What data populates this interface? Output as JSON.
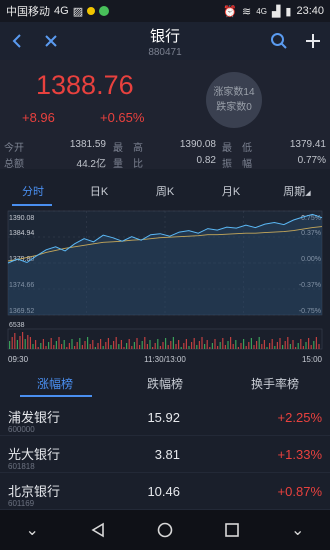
{
  "status": {
    "carrier": "中国移动",
    "net": "4G",
    "time": "23:40",
    "net2": "4G"
  },
  "nav": {
    "title": "银行",
    "code": "880471",
    "back": "‹",
    "close": "✕",
    "add": "+"
  },
  "quote": {
    "price": "1388.76",
    "change": "+8.96",
    "change_pct": "+0.65%",
    "bubble_up": "涨家数14",
    "bubble_down": "跌家数0"
  },
  "stats": [
    {
      "label": "今开",
      "value": "1381.59"
    },
    {
      "label": "最　高",
      "value": "1390.08"
    },
    {
      "label": "最　低",
      "value": "1379.41"
    },
    {
      "label": "总额",
      "value": "44.2亿"
    },
    {
      "label": "量　比",
      "value": "0.82"
    },
    {
      "label": "振　幅",
      "value": "0.77%"
    }
  ],
  "tabs": [
    "分时",
    "日K",
    "周K",
    "月K",
    "周期"
  ],
  "chart_data": {
    "type": "line",
    "title": "",
    "y_ticks_left": [
      "1390.08",
      "1384.94",
      "1379.80",
      "1374.66",
      "1369.52"
    ],
    "y_ticks_right": [
      "0.75%",
      "0.37%",
      "0.00%",
      "-0.37%",
      "-0.75%"
    ],
    "ylim": [
      1369.52,
      1390.08
    ],
    "x_ticks": [
      "09:30",
      "11:30/13:00",
      "15:00"
    ],
    "volume_max_label": "6538",
    "series": [
      {
        "values": [
          1379.8,
          1380.6,
          1379.9,
          1381.2,
          1382.4,
          1383.0,
          1382.2,
          1383.6,
          1384.6,
          1384.0,
          1385.3,
          1384.8,
          1384.1,
          1385.0,
          1384.3,
          1385.4,
          1385.6,
          1385.1,
          1385.9,
          1386.2,
          1385.7,
          1386.6,
          1386.3,
          1386.9,
          1386.7,
          1387.3,
          1386.8,
          1387.5,
          1387.8,
          1387.4,
          1388.3,
          1388.9,
          1389.4,
          1388.76
        ]
      },
      {
        "values": [
          1380.2,
          1380.5,
          1380.9,
          1381.3,
          1381.9,
          1382.3,
          1382.7,
          1383.0,
          1383.3,
          1383.6,
          1383.9,
          1384.0,
          1384.1,
          1384.3,
          1384.4,
          1384.6,
          1384.8,
          1384.9,
          1385.0,
          1385.1,
          1385.2,
          1385.4,
          1385.4,
          1385.5,
          1385.6,
          1385.7,
          1385.7,
          1385.8,
          1385.9,
          1386.0,
          1386.2,
          1386.5,
          1386.8,
          1387.0
        ]
      }
    ]
  },
  "rank_tabs": [
    "涨幅榜",
    "跌幅榜",
    "换手率榜"
  ],
  "rows": [
    {
      "name": "浦发银行",
      "code": "600000",
      "price": "15.92",
      "pct": "+2.25%"
    },
    {
      "name": "光大银行",
      "code": "601818",
      "price": "3.81",
      "pct": "+1.33%"
    },
    {
      "name": "北京银行",
      "code": "601169",
      "price": "10.46",
      "pct": "+0.87%"
    }
  ],
  "colors": {
    "up": "#e8413e",
    "accent": "#4a8ff0",
    "price_line": "#5bb8f5",
    "avg_line": "#c6a85a"
  }
}
